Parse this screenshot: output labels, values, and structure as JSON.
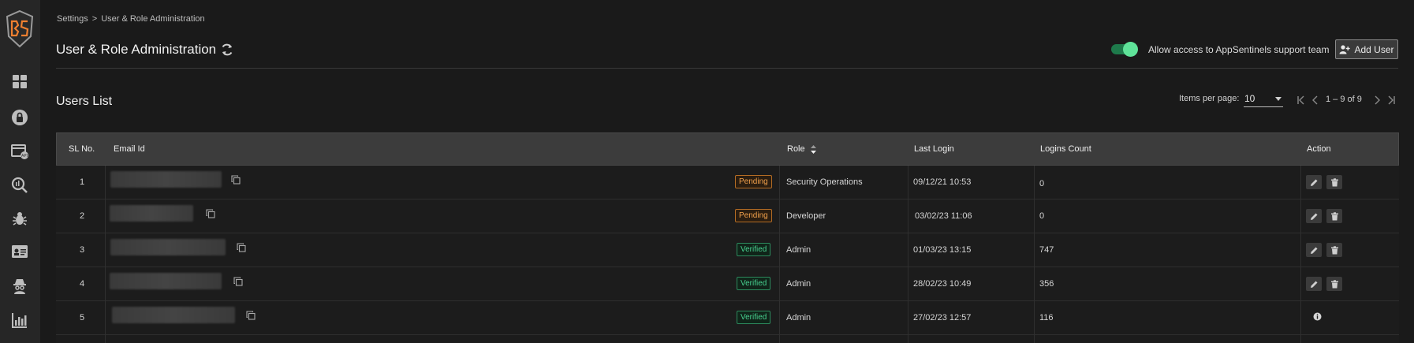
{
  "breadcrumb": {
    "parent": "Settings",
    "separator": ">",
    "current": "User & Role Administration"
  },
  "header": {
    "title": "User & Role Administration",
    "toggle_label": "Allow access to AppSentinels support team",
    "toggle_on": true,
    "add_user_label": "Add User"
  },
  "section": {
    "title": "Users List"
  },
  "pagination": {
    "items_per_page_label": "Items per page:",
    "items_per_page": "10",
    "range": "1 – 9 of 9"
  },
  "table": {
    "headers": {
      "sl": "SL No.",
      "email": "Email Id",
      "role": "Role",
      "last_login": "Last Login",
      "logins_count": "Logins Count",
      "action": "Action"
    },
    "rows": [
      {
        "sl": "1",
        "status": "Pending",
        "role": "Security Operations",
        "last_login": "09/12/21 10:53",
        "logins": "0"
      },
      {
        "sl": "2",
        "status": "Pending",
        "role": "Developer",
        "last_login": "03/02/23 11:06",
        "logins": "0"
      },
      {
        "sl": "3",
        "status": "Verified",
        "role": "Admin",
        "last_login": "01/03/23 13:15",
        "logins": "747"
      },
      {
        "sl": "4",
        "status": "Verified",
        "role": "Admin",
        "last_login": "28/02/23 10:49",
        "logins": "356"
      },
      {
        "sl": "5",
        "status": "Verified",
        "role": "Admin",
        "last_login": "27/02/23 12:57",
        "logins": "116"
      }
    ]
  },
  "colors": {
    "accent_green": "#5fe399",
    "pending": "#f0a04b",
    "verified": "#48d190",
    "brand_orange": "#f08030"
  },
  "icons": [
    "dashboard-icon",
    "lock-icon",
    "api-icon",
    "search-icon",
    "bug-icon",
    "id-card-icon",
    "spy-icon",
    "bar-chart-icon"
  ]
}
